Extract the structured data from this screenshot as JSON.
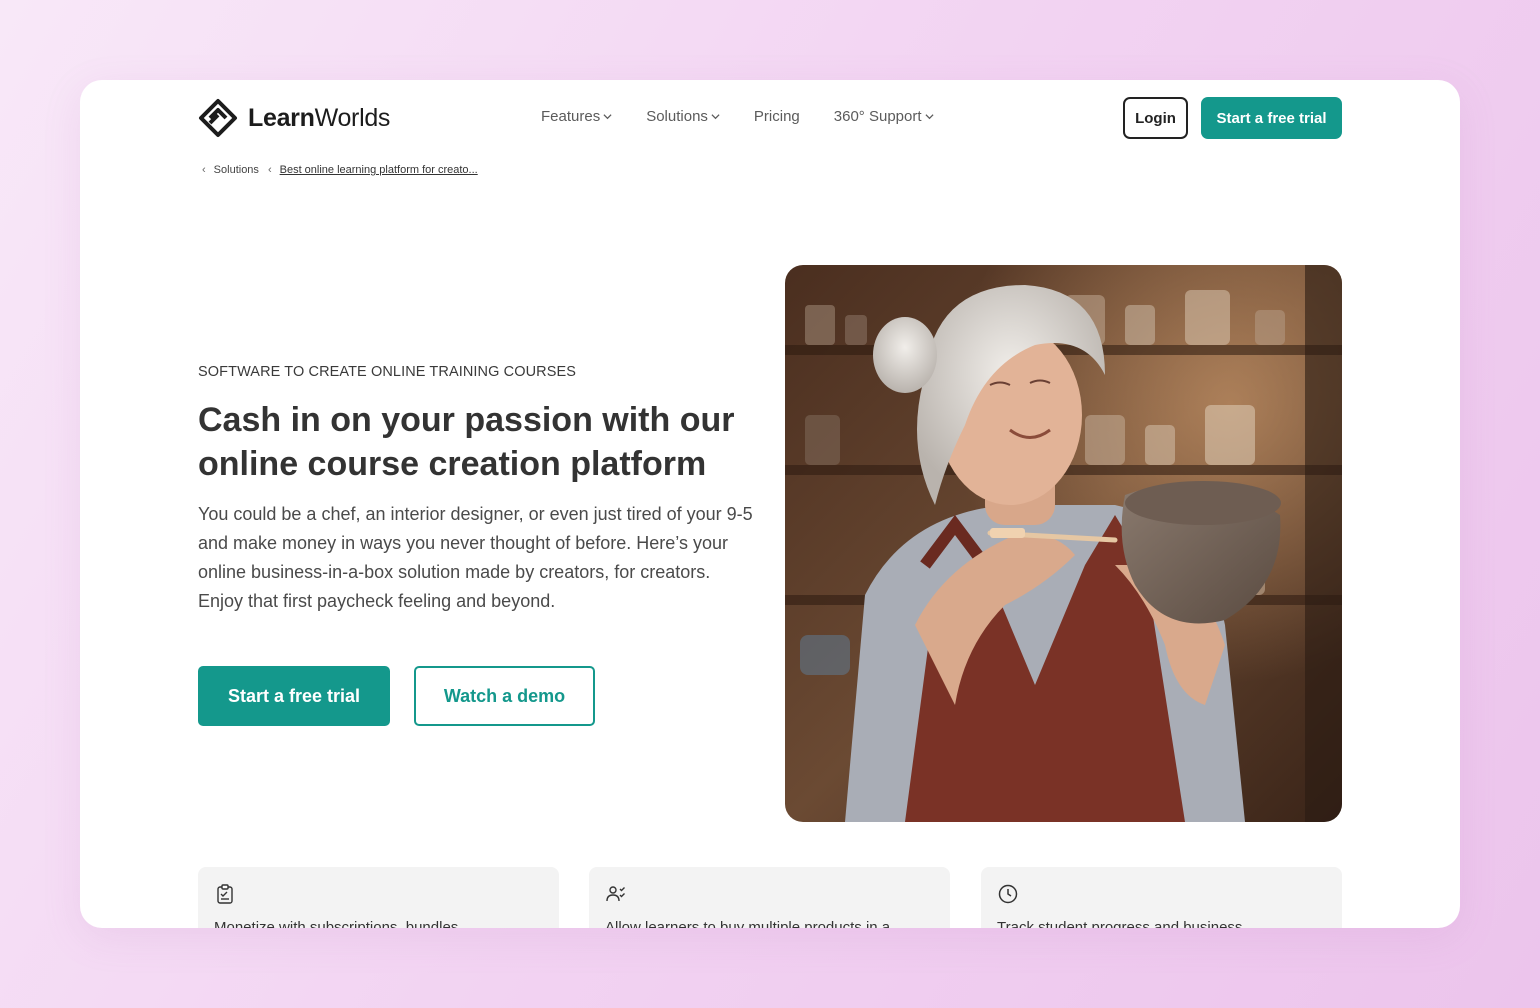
{
  "brand": {
    "name_bold": "Learn",
    "name_light": "Worlds"
  },
  "nav": {
    "items": [
      {
        "label": "Features",
        "dropdown": true
      },
      {
        "label": "Solutions",
        "dropdown": true
      },
      {
        "label": "Pricing",
        "dropdown": false
      },
      {
        "label": "360° Support",
        "dropdown": true
      }
    ],
    "login_label": "Login",
    "trial_label": "Start a free trial"
  },
  "breadcrumb": {
    "items": [
      "Solutions",
      "Best online learning platform for creato..."
    ]
  },
  "hero": {
    "eyebrow": "SOFTWARE TO CREATE ONLINE TRAINING COURSES",
    "title": "Cash in on your passion with our online course creation platform",
    "description": "You could be a chef, an interior designer, or even just tired of your 9-5 and make money in ways you never thought of before. Here’s your online business-in-a-box solution made by creators, for creators. Enjoy that first paycheck feeling and beyond.",
    "primary_cta": "Start a free trial",
    "secondary_cta": "Watch a demo",
    "image_icon": "woman-painting-pottery-photo"
  },
  "features": [
    {
      "icon": "clipboard-check-icon",
      "text": "Monetize with subscriptions, bundles..."
    },
    {
      "icon": "users-check-icon",
      "text": "Allow learners to buy multiple products in a..."
    },
    {
      "icon": "clock-icon",
      "text": "Track student progress and business..."
    }
  ],
  "colors": {
    "accent": "#14988c",
    "background_gradient_start": "#f8e8f8",
    "background_gradient_end": "#ecc4ec"
  }
}
